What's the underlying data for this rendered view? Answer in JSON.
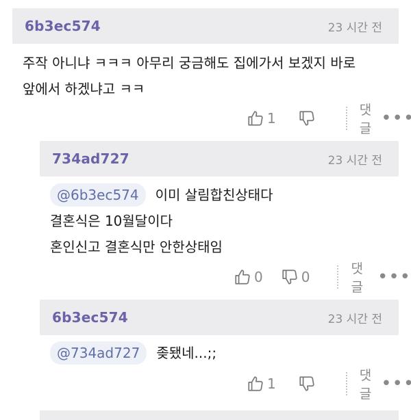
{
  "comments": [
    {
      "username": "6b3ec574",
      "time": "23 시간 전",
      "lines": [
        "주작 아니냐 ㅋㅋㅋ 아무리 궁금해도 집에가서 보겠지 바로",
        "앞에서 하겠냐고 ㅋㅋ"
      ],
      "likes": "1",
      "dislikes": "",
      "reply_label": "댓글"
    },
    {
      "username": "734ad727",
      "time": "23 시간 전",
      "mention": "@6b3ec574",
      "lines": [
        "이미 살림합친상태다",
        "결혼식은 10월달이다",
        "혼인신고 결혼식만 안한상태임"
      ],
      "likes": "0",
      "dislikes": "0",
      "reply_label": "댓글"
    },
    {
      "username": "6b3ec574",
      "time": "23 시간 전",
      "mention": "@734ad727",
      "lines": [
        "좆됐네...;;"
      ],
      "likes": "1",
      "dislikes": "",
      "reply_label": "댓글"
    }
  ],
  "more_glyph": "•••",
  "colors": {
    "header_bg": "#ececee",
    "username": "#6a63a8",
    "mention_bg": "#eef0f8"
  }
}
